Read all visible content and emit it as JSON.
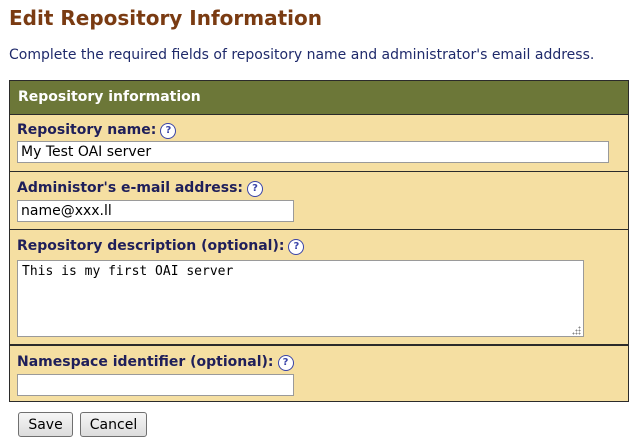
{
  "page": {
    "title": "Edit Repository Information",
    "intro": "Complete the required fields of repository name and administrator's email address."
  },
  "form": {
    "section_title": "Repository information",
    "help_glyph": "?",
    "fields": {
      "repository_name": {
        "label": "Repository name:",
        "value": "My Test OAI server"
      },
      "admin_email": {
        "label": "Administor's e-mail address:",
        "value": "name@xxx.ll"
      },
      "description": {
        "label": "Repository description (optional):",
        "value": "This is my first OAI server"
      },
      "namespace": {
        "label": "Namespace identifier (optional):",
        "value": ""
      }
    }
  },
  "buttons": {
    "save": "Save",
    "cancel": "Cancel"
  },
  "colors": {
    "title": "#7a3b12",
    "intro_text": "#1f2a6b",
    "header_bg": "#6c7738",
    "form_bg": "#f5dfa2",
    "label_text": "#1f1f5a",
    "help_icon": "#3a44a8"
  },
  "icons": {
    "help": "help-icon",
    "resize": "resize-grip-icon"
  }
}
